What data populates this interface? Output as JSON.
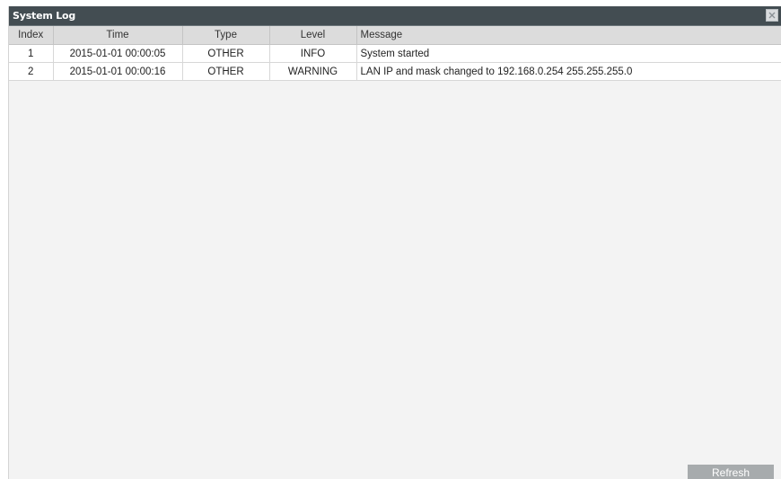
{
  "dialog": {
    "title": "System Log",
    "close_icon": "close-icon"
  },
  "table": {
    "columns": [
      "Index",
      "Time",
      "Type",
      "Level",
      "Message"
    ],
    "rows": [
      {
        "index": "1",
        "time": "2015-01-01 00:00:05",
        "type": "OTHER",
        "level": "INFO",
        "message": "System started"
      },
      {
        "index": "2",
        "time": "2015-01-01 00:00:16",
        "type": "OTHER",
        "level": "WARNING",
        "message": "LAN IP and mask changed to 192.168.0.254 255.255.255.0"
      }
    ]
  },
  "actions": {
    "refresh_label": "Refresh"
  },
  "colors": {
    "titlebar": "#434d52",
    "header_bg": "#dcdcdc",
    "refresh_bg": "#a7abad"
  }
}
